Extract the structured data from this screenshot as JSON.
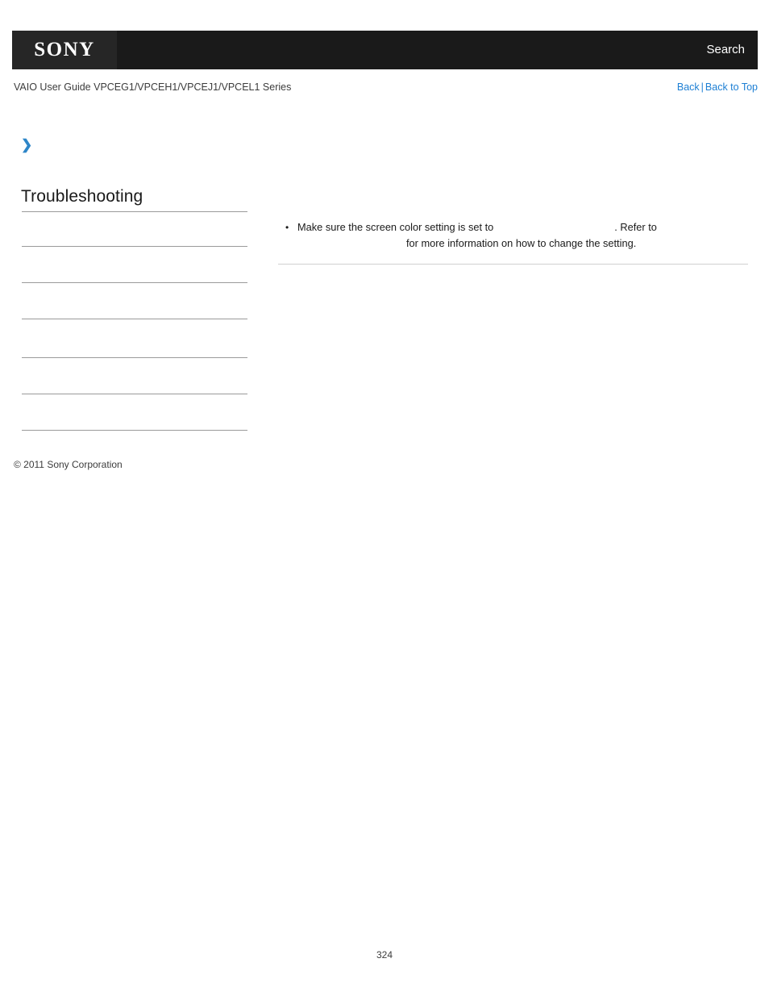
{
  "header": {
    "logo": "SONY",
    "search_label": "Search",
    "logo_background": "#262626",
    "bar_background": "#1a1a1a"
  },
  "subheader": {
    "guide_title": "VAIO User Guide VPCEG1/VPCEH1/VPCEJ1/VPCEL1 Series",
    "back_label": "Back",
    "separator": "|",
    "back_to_top_label": "Back to Top",
    "link_color": "#1d7fd4"
  },
  "sidebar": {
    "breadcrumb_icon": "chevron-right-icon",
    "breadcrumb_text": "",
    "title": "Troubleshooting",
    "accent_color": "#2e86c8",
    "items": [
      {
        "label": ""
      },
      {
        "label": ""
      },
      {
        "label": ""
      },
      {
        "label": ""
      },
      {
        "label": ""
      },
      {
        "label": ""
      }
    ],
    "copyright": "© 2011 Sony Corporation"
  },
  "main": {
    "heading": "",
    "bullets": [
      {
        "text_before_gap": "Make sure the screen color setting is set to",
        "text_after_gap": ". Refer to",
        "text_line2": "for more information on how to change the setting."
      }
    ]
  },
  "footer": {
    "page_number": "324"
  }
}
